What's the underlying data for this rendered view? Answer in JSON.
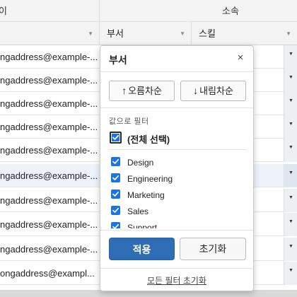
{
  "grid": {
    "group_header": {
      "left_label": "이",
      "right_label": "소속"
    },
    "columns": [
      {
        "label": ""
      },
      {
        "label": "부서"
      },
      {
        "label": "스킬"
      }
    ],
    "rows": [
      {
        "email": "ngaddress@example-..."
      },
      {
        "email": "ngaddress@example-..."
      },
      {
        "email": "ngaddress@example-..."
      },
      {
        "email": "ngaddress@example-..."
      },
      {
        "email": "ngaddress@example-..."
      },
      {
        "email": "ngaddress@example-..."
      },
      {
        "email": "ngaddress@example-..."
      },
      {
        "email": "ngaddress@example-..."
      },
      {
        "email": "ngaddress@example-..."
      },
      {
        "email": "ongaddress@exampl..."
      }
    ],
    "highlight_color": "#eef3fb"
  },
  "filter_popup": {
    "title": "부서",
    "close_symbol": "×",
    "sort_asc_label": "오름차순",
    "sort_desc_label": "내림차순",
    "sort_asc_arrow": "↑",
    "sort_desc_arrow": "↓",
    "filter_by_value_label": "값으로 필터",
    "select_all_label": "(전체 선택)",
    "select_all_checked": true,
    "options": [
      {
        "label": "Design",
        "checked": true
      },
      {
        "label": "Engineering",
        "checked": true
      },
      {
        "label": "Marketing",
        "checked": true
      },
      {
        "label": "Sales",
        "checked": true
      },
      {
        "label": "Support",
        "checked": true
      }
    ],
    "apply_label": "적용",
    "reset_label": "초기화",
    "clear_all_label": "모든 필터 초기화",
    "accent_color": "#2f6db5",
    "checkbox_color": "#1a73e8"
  }
}
